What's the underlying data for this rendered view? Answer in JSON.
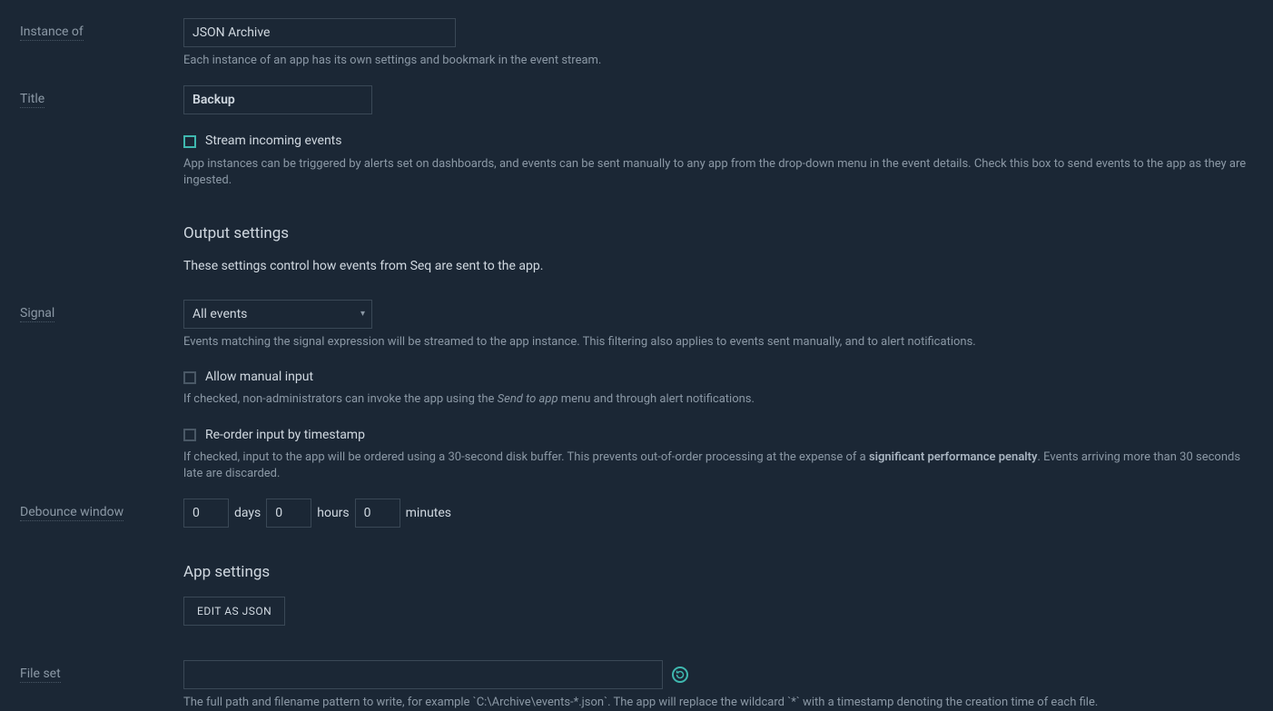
{
  "instance_of": {
    "label": "Instance of",
    "value": "JSON Archive",
    "help": "Each instance of an app has its own settings and bookmark in the event stream."
  },
  "title": {
    "label": "Title",
    "value": "Backup"
  },
  "stream_events": {
    "label": "Stream incoming events",
    "help": "App instances can be triggered by alerts set on dashboards, and events can be sent manually to any app from the drop-down menu in the event details. Check this box to send events to the app as they are ingested."
  },
  "output_settings": {
    "heading": "Output settings",
    "desc": "These settings control how events from Seq are sent to the app."
  },
  "signal": {
    "label": "Signal",
    "value": "All events",
    "help": "Events matching the signal expression will be streamed to the app instance. This filtering also applies to events sent manually, and to alert notifications."
  },
  "allow_manual": {
    "label": "Allow manual input",
    "help_pre": "If checked, non-administrators can invoke the app using the ",
    "help_em": "Send to app",
    "help_post": " menu and through alert notifications."
  },
  "reorder": {
    "label": "Re-order input by timestamp",
    "help_pre": "If checked, input to the app will be ordered using a 30-second disk buffer. This prevents out-of-order processing at the expense of a ",
    "help_strong": "significant performance penalty",
    "help_post": ". Events arriving more than 30 seconds late are discarded."
  },
  "debounce": {
    "label": "Debounce window",
    "days": "0",
    "days_label": "days",
    "hours": "0",
    "hours_label": "hours",
    "minutes": "0",
    "minutes_label": "minutes"
  },
  "app_settings": {
    "heading": "App settings",
    "edit_json": "EDIT AS JSON"
  },
  "file_set": {
    "label": "File set",
    "value": "",
    "help": "The full path and filename pattern to write, for example `C:\\Archive\\events-*.json`. The app will replace the wildcard `*` with a timestamp denoting the creation time of each file."
  }
}
